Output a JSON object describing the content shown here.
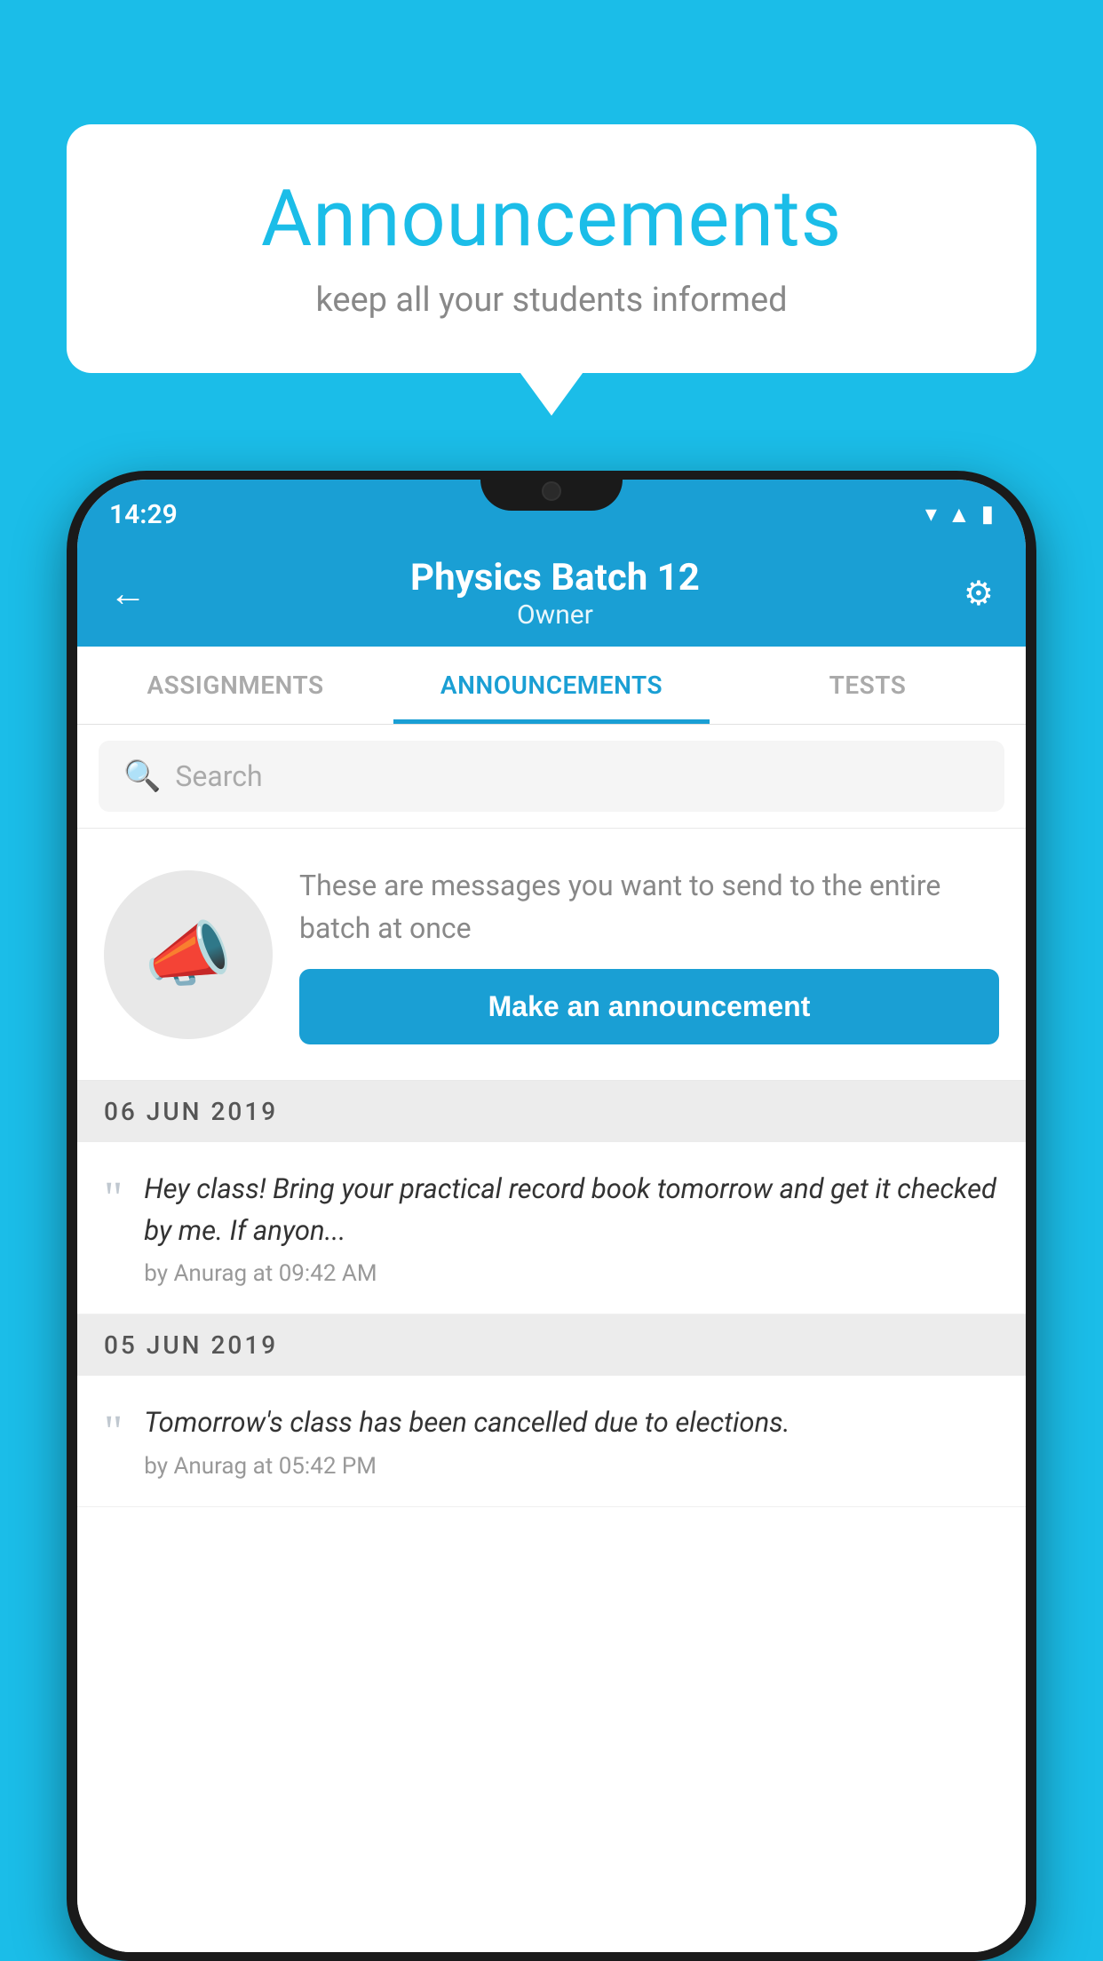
{
  "background_color": "#1bbde8",
  "speech_bubble": {
    "title": "Announcements",
    "subtitle": "keep all your students informed"
  },
  "phone": {
    "status_bar": {
      "time": "14:29"
    },
    "app_bar": {
      "back_label": "←",
      "title": "Physics Batch 12",
      "subtitle": "Owner",
      "settings_label": "⚙"
    },
    "tabs": [
      {
        "label": "ASSIGNMENTS",
        "active": false
      },
      {
        "label": "ANNOUNCEMENTS",
        "active": true
      },
      {
        "label": "TESTS",
        "active": false
      },
      {
        "label": "•••",
        "active": false
      }
    ],
    "search": {
      "placeholder": "Search"
    },
    "promo": {
      "description": "These are messages you want to send to the entire batch at once",
      "button_label": "Make an announcement"
    },
    "announcements": [
      {
        "date": "06  JUN  2019",
        "text": "Hey class! Bring your practical record book tomorrow and get it checked by me. If anyon...",
        "meta": "by Anurag at 09:42 AM"
      },
      {
        "date": "05  JUN  2019",
        "text": "Tomorrow's class has been cancelled due to elections.",
        "meta": "by Anurag at 05:42 PM"
      }
    ]
  }
}
